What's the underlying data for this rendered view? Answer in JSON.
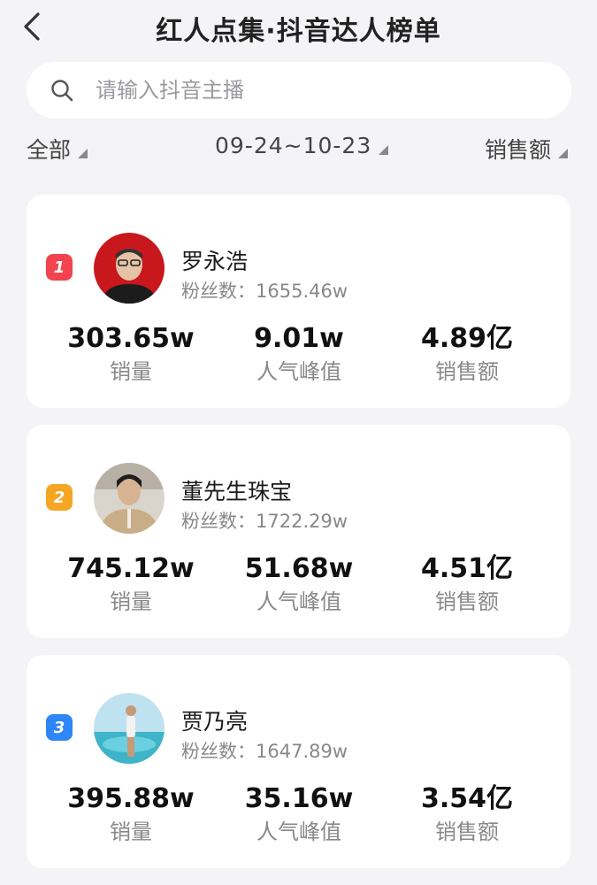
{
  "header": {
    "title": "红人点集·抖音达人榜单"
  },
  "search": {
    "placeholder": "请输入抖音主播",
    "icon": "search-icon"
  },
  "filters": {
    "category": "全部",
    "date_range": "09-24~10-23",
    "sort_by": "销售额"
  },
  "stat_labels": {
    "sales_volume": "销量",
    "peak_popularity": "人气峰值",
    "sales_amount": "销售额"
  },
  "fans_prefix": "粉丝数：",
  "rankings": [
    {
      "rank": "1",
      "rank_color": "#f2434e",
      "name": "罗永浩",
      "fans": "1655.46w",
      "sales_volume": "303.65w",
      "peak_popularity": "9.01w",
      "sales_amount": "4.89亿"
    },
    {
      "rank": "2",
      "rank_color": "#f5a623",
      "name": "董先生珠宝",
      "fans": "1722.29w",
      "sales_volume": "745.12w",
      "peak_popularity": "51.68w",
      "sales_amount": "4.51亿"
    },
    {
      "rank": "3",
      "rank_color": "#2f86f6",
      "name": "贾乃亮",
      "fans": "1647.89w",
      "sales_volume": "395.88w",
      "peak_popularity": "35.16w",
      "sales_amount": "3.54亿"
    }
  ]
}
